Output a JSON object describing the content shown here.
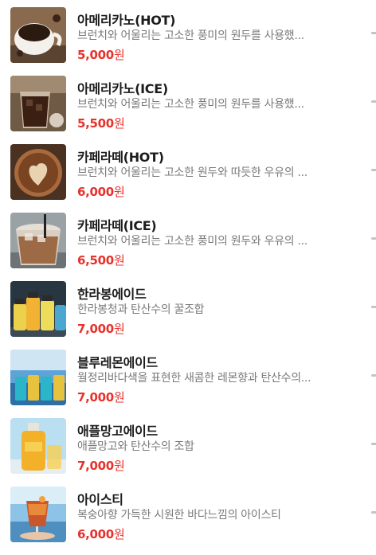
{
  "menu": {
    "items": [
      {
        "name": "아메리카노(HOT)",
        "desc": "브런치와 어울리는 고소한 풍미의 원두를 사용했...",
        "price": "5,000",
        "unit": "원",
        "image": "hot-americano-cup",
        "colors": {
          "bg": "#8a6a4e",
          "cup": "#f4f1ec",
          "liquid": "#2b1a10"
        }
      },
      {
        "name": "아메리카노(ICE)",
        "desc": "브런치와 어울리는 고소한 풍미의 원두를 사용했...",
        "price": "5,500",
        "unit": "원",
        "image": "iced-americano-glass",
        "colors": {
          "bg": "#6f5a45",
          "cup": "#c9b9a4",
          "liquid": "#3a1f12"
        }
      },
      {
        "name": "카페라떼(HOT)",
        "desc": "브런치와 어울리는 고소한 원두와 따듯한 우유의 ...",
        "price": "6,000",
        "unit": "원",
        "image": "hot-latte-art",
        "colors": {
          "bg": "#4a3122",
          "cup": "#a86a3c",
          "liquid": "#e8d2b0"
        }
      },
      {
        "name": "카페라떼(ICE)",
        "desc": "브런치와 어울리는 고소한 풍미의 원두와 우유의 ...",
        "price": "6,500",
        "unit": "원",
        "image": "iced-latte-glass",
        "colors": {
          "bg": "#9aa2a5",
          "cup": "#d9cfc2",
          "liquid": "#9c6b45"
        }
      },
      {
        "name": "한라봉에이드",
        "desc": "한라봉청과 탄산수의 꿀조합",
        "price": "7,000",
        "unit": "원",
        "image": "hallabong-ade-bottles",
        "colors": {
          "bg": "#283642",
          "cup": "#f2b234",
          "liquid": "#ecd24a"
        }
      },
      {
        "name": "블루레몬에이드",
        "desc": "월정리바다색을 표현한 새콤한 레몬향과 탄산수의...",
        "price": "7,000",
        "unit": "원",
        "image": "blue-lemon-ade-bottles",
        "colors": {
          "bg": "#5ea3d6",
          "cup": "#2bb5c9",
          "liquid": "#e7c23c"
        }
      },
      {
        "name": "애플망고에이드",
        "desc": "애플망고와 탄산수의 조합",
        "price": "7,000",
        "unit": "원",
        "image": "apple-mango-ade-bottle",
        "colors": {
          "bg": "#b9dff0",
          "cup": "#f3b12a",
          "liquid": "#f7cf52"
        }
      },
      {
        "name": "아이스티",
        "desc": "복숭아향 가득한 시원한 바다느낌의 아이스티",
        "price": "6,000",
        "unit": "원",
        "image": "iced-tea-glass",
        "colors": {
          "bg": "#8cc3e6",
          "cup": "#c9572b",
          "liquid": "#e88a3a"
        }
      }
    ]
  }
}
